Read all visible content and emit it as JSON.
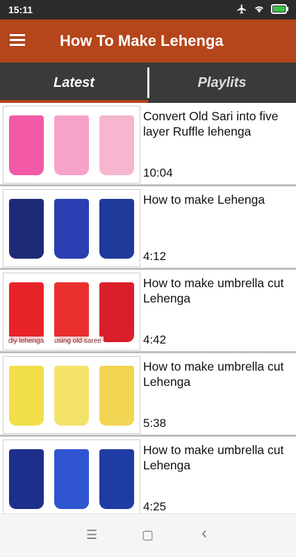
{
  "status": {
    "time": "15:11"
  },
  "appbar": {
    "title": "How To Make Lehenga"
  },
  "tabs": [
    {
      "label": "Latest"
    },
    {
      "label": "Playlits"
    }
  ],
  "videos": [
    {
      "title": "Convert Old Sari into five layer Ruffle lehenga",
      "duration": "10:04",
      "colors": [
        "#f25aa8",
        "#f7a3c9",
        "#f6b6cf"
      ]
    },
    {
      "title": "How to make Lehenga",
      "duration": "4:12",
      "colors": [
        "#1e2a78",
        "#2a3fb1",
        "#1f3a9a"
      ]
    },
    {
      "title": "How to make umbrella cut Lehenga",
      "duration": "4:42",
      "colors": [
        "#e8232a",
        "#ea2f2f",
        "#d81f2a"
      ],
      "overlay": "diy lehenga",
      "overlay2": "using old saree"
    },
    {
      "title": "How to make umbrella cut Lehenga",
      "duration": "5:38",
      "colors": [
        "#f3df4a",
        "#f4e36a",
        "#f2d552"
      ]
    },
    {
      "title": "How to make umbrella cut Lehenga",
      "duration": "4:25",
      "colors": [
        "#1d2f8b",
        "#2f55d1",
        "#1f3ca4"
      ]
    }
  ],
  "nav": {
    "menu_icon": "☰",
    "home_icon": "▢",
    "back_icon": "‹"
  }
}
